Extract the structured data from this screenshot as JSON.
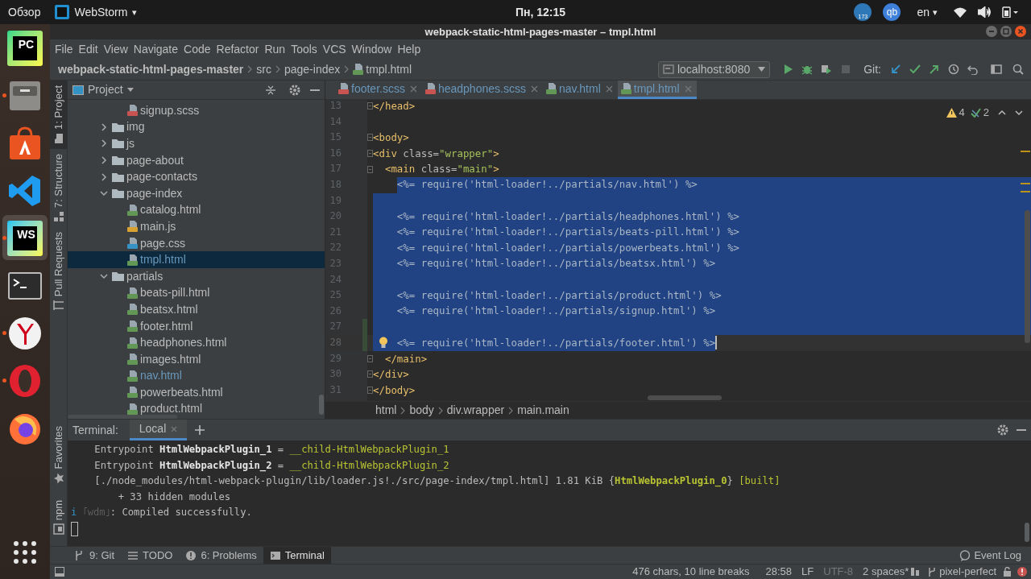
{
  "top_bar": {
    "activities": "Обзор",
    "app_menu": "WebStorm",
    "app_caret": "▾",
    "clock": "Пн, 12:15",
    "badge": "173",
    "qb": "qb",
    "language": "en",
    "language_caret": "▾"
  },
  "dock": [
    {
      "kind": "pycharm",
      "label": "PC",
      "running": false,
      "selected": false
    },
    {
      "kind": "files",
      "running": true,
      "selected": false
    },
    {
      "kind": "store",
      "running": false,
      "selected": false
    },
    {
      "kind": "vscode",
      "running": false,
      "selected": false
    },
    {
      "kind": "webstorm",
      "label": "WS",
      "running": true,
      "selected": true
    },
    {
      "kind": "terminal",
      "running": false,
      "selected": false
    },
    {
      "kind": "yandex",
      "running": true,
      "selected": false
    },
    {
      "kind": "opera",
      "running": true,
      "selected": false
    },
    {
      "kind": "firefox",
      "running": false,
      "selected": false
    },
    {
      "kind": "apps",
      "running": false,
      "selected": false
    }
  ],
  "window": {
    "title": "webpack-static-html-pages-master – tmpl.html"
  },
  "menu": [
    "File",
    "Edit",
    "View",
    "Navigate",
    "Code",
    "Refactor",
    "Run",
    "Tools",
    "VCS",
    "Window",
    "Help"
  ],
  "breadcrumbs": [
    {
      "kind": "project",
      "label": "webpack-static-html-pages-master"
    },
    {
      "kind": "folder",
      "label": "src"
    },
    {
      "kind": "folder",
      "label": "page-index"
    },
    {
      "kind": "html",
      "label": "tmpl.html"
    }
  ],
  "toolbar": {
    "run_config": "localhost:8080",
    "git_label": "Git:"
  },
  "left_stripe": [
    {
      "kind": "project",
      "label": "1: Project",
      "selected": true
    },
    {
      "kind": "structure",
      "label": "7: Structure",
      "selected": false
    },
    {
      "kind": "pull",
      "label": "Pull Requests",
      "selected": false
    }
  ],
  "left_stripe_bottom": [
    {
      "kind": "favorites",
      "label": "Favorites"
    },
    {
      "kind": "npm",
      "label": "npm"
    }
  ],
  "project": {
    "title": "Project",
    "tree_above": [
      {
        "name": "signup.scss",
        "kind": "scss",
        "selected": false,
        "modified": false
      }
    ],
    "tree": [
      {
        "name": "img",
        "kind": "folder",
        "expanded": false,
        "selected": false,
        "modified": false
      },
      {
        "name": "js",
        "kind": "folder",
        "expanded": false,
        "selected": false,
        "modified": false
      },
      {
        "name": "page-about",
        "kind": "folder",
        "expanded": false,
        "selected": false,
        "modified": false
      },
      {
        "name": "page-contacts",
        "kind": "folder",
        "expanded": false,
        "selected": false,
        "modified": false
      },
      {
        "name": "page-index",
        "kind": "folder",
        "expanded": true,
        "selected": false,
        "modified": false,
        "children": [
          {
            "name": "catalog.html",
            "kind": "html",
            "selected": false,
            "modified": false
          },
          {
            "name": "main.js",
            "kind": "js",
            "selected": false,
            "modified": false
          },
          {
            "name": "page.css",
            "kind": "css",
            "selected": false,
            "modified": false
          },
          {
            "name": "tmpl.html",
            "kind": "html",
            "selected": true,
            "modified": true
          }
        ]
      },
      {
        "name": "partials",
        "kind": "folder",
        "expanded": true,
        "selected": false,
        "modified": false,
        "children": [
          {
            "name": "beats-pill.html",
            "kind": "html",
            "selected": false,
            "modified": false
          },
          {
            "name": "beatsx.html",
            "kind": "html",
            "selected": false,
            "modified": false
          },
          {
            "name": "footer.html",
            "kind": "html",
            "selected": false,
            "modified": false
          },
          {
            "name": "headphones.html",
            "kind": "html",
            "selected": false,
            "modified": false
          },
          {
            "name": "images.html",
            "kind": "html",
            "selected": false,
            "modified": false
          },
          {
            "name": "nav.html",
            "kind": "html",
            "selected": false,
            "modified": true
          },
          {
            "name": "powerbeats.html",
            "kind": "html",
            "selected": false,
            "modified": false
          },
          {
            "name": "product.html",
            "kind": "html",
            "selected": false,
            "modified": false
          }
        ]
      }
    ]
  },
  "editor": {
    "tabs": [
      {
        "label": "footer.scss",
        "kind": "scss",
        "selected": false,
        "modified": true
      },
      {
        "label": "headphones.scss",
        "kind": "scss",
        "selected": false,
        "modified": true
      },
      {
        "label": "nav.html",
        "kind": "html",
        "selected": false,
        "modified": true
      },
      {
        "label": "tmpl.html",
        "kind": "html",
        "selected": true,
        "modified": true
      }
    ],
    "inspections": {
      "warnings": "4",
      "weak_warnings": "2"
    },
    "lines": [
      {
        "number": "13",
        "fold": true,
        "changed": false,
        "selected": false,
        "bulb": false,
        "caret": false,
        "segments": [
          {
            "kind": "tag",
            "text": "</head>"
          }
        ]
      },
      {
        "number": "14",
        "fold": false,
        "changed": false,
        "selected": false,
        "bulb": false,
        "caret": false
      },
      {
        "number": "15",
        "fold": true,
        "changed": false,
        "selected": false,
        "bulb": false,
        "caret": false,
        "segments": [
          {
            "kind": "tag",
            "text": "<body>"
          }
        ]
      },
      {
        "number": "16",
        "fold": true,
        "changed": false,
        "selected": false,
        "bulb": false,
        "caret": false,
        "segments": [
          {
            "kind": "tag",
            "text": "<div"
          },
          {
            "kind": "attr",
            "text": " class="
          },
          {
            "kind": "value",
            "text": "\"wrapper\""
          },
          {
            "kind": "tag",
            "text": ">"
          }
        ]
      },
      {
        "number": "17",
        "fold": true,
        "changed": false,
        "selected": false,
        "bulb": false,
        "caret": false,
        "segments": [
          {
            "kind": "tag",
            "text": "  <main"
          },
          {
            "kind": "attr",
            "text": " class="
          },
          {
            "kind": "value",
            "text": "\"main\""
          },
          {
            "kind": "tag",
            "text": ">"
          }
        ]
      },
      {
        "number": "18",
        "fold": false,
        "changed": false,
        "selected": true,
        "bulb": false,
        "caret": false,
        "segments": [
          {
            "kind": "text",
            "text": "    <%= require('html-loader!../partials/nav.html') %>"
          }
        ]
      },
      {
        "number": "19",
        "fold": false,
        "changed": false,
        "selected": true,
        "bulb": false,
        "caret": false
      },
      {
        "number": "20",
        "fold": false,
        "changed": false,
        "selected": true,
        "bulb": false,
        "caret": false,
        "segments": [
          {
            "kind": "text",
            "text": "    <%= require('html-loader!../partials/headphones.html') %>"
          }
        ]
      },
      {
        "number": "21",
        "fold": false,
        "changed": false,
        "selected": true,
        "bulb": false,
        "caret": false,
        "segments": [
          {
            "kind": "text",
            "text": "    <%= require('html-loader!../partials/beats-pill.html') %>"
          }
        ]
      },
      {
        "number": "22",
        "fold": false,
        "changed": false,
        "selected": true,
        "bulb": false,
        "caret": false,
        "segments": [
          {
            "kind": "text",
            "text": "    <%= require('html-loader!../partials/powerbeats.html') %>"
          }
        ]
      },
      {
        "number": "23",
        "fold": false,
        "changed": false,
        "selected": true,
        "bulb": false,
        "caret": false,
        "segments": [
          {
            "kind": "text",
            "text": "    <%= require('html-loader!../partials/beatsx.html') %>"
          }
        ]
      },
      {
        "number": "24",
        "fold": false,
        "changed": false,
        "selected": true,
        "bulb": false,
        "caret": false
      },
      {
        "number": "25",
        "fold": false,
        "changed": false,
        "selected": true,
        "bulb": false,
        "caret": false,
        "segments": [
          {
            "kind": "text",
            "text": "    <%= require('html-loader!../partials/product.html') %>"
          }
        ]
      },
      {
        "number": "26",
        "fold": false,
        "changed": false,
        "selected": true,
        "bulb": false,
        "caret": false,
        "segments": [
          {
            "kind": "text",
            "text": "    <%= require('html-loader!../partials/signup.html') %>"
          }
        ]
      },
      {
        "number": "27",
        "fold": false,
        "changed": true,
        "selected": true,
        "bulb": false,
        "caret": false
      },
      {
        "number": "28",
        "fold": false,
        "changed": true,
        "selected": true,
        "bulb": true,
        "caret": true,
        "segments": [
          {
            "kind": "text",
            "text": "    <%= require('html-loader!../partials/footer.html') %>"
          }
        ]
      },
      {
        "number": "29",
        "fold": true,
        "changed": false,
        "selected": false,
        "bulb": false,
        "caret": false,
        "segments": [
          {
            "kind": "tag",
            "text": "  </main>"
          }
        ]
      },
      {
        "number": "30",
        "fold": true,
        "changed": false,
        "selected": false,
        "bulb": false,
        "caret": false,
        "segments": [
          {
            "kind": "tag",
            "text": "</div>"
          }
        ]
      },
      {
        "number": "31",
        "fold": true,
        "changed": false,
        "selected": false,
        "bulb": false,
        "caret": false,
        "segments": [
          {
            "kind": "tag",
            "text": "</body>"
          }
        ]
      }
    ],
    "breadcrumbs": [
      "html",
      "body",
      "div.wrapper",
      "main.main"
    ]
  },
  "terminal": {
    "title": "Terminal:",
    "tabs": [
      {
        "label": "Local",
        "selected": true
      }
    ],
    "cursor": true,
    "lines": [
      [
        {
          "kind": "plain",
          "text": "    Entrypoint "
        },
        {
          "kind": "bold",
          "text": "HtmlWebpackPlugin_1"
        },
        {
          "kind": "plain",
          "text": " = "
        },
        {
          "kind": "accent",
          "text": "__child-HtmlWebpackPlugin_1"
        }
      ],
      [
        {
          "kind": "plain",
          "text": "    Entrypoint "
        },
        {
          "kind": "bold",
          "text": "HtmlWebpackPlugin_2"
        },
        {
          "kind": "plain",
          "text": " = "
        },
        {
          "kind": "accent",
          "text": "__child-HtmlWebpackPlugin_2"
        }
      ],
      [
        {
          "kind": "plain",
          "text": "    [./node_modules/html-webpack-plugin/lib/loader.js!./src/page-index/tmpl.html] 1.81 KiB {"
        },
        {
          "kind": "accent_bold",
          "text": "HtmlWebpackPlugin_0"
        },
        {
          "kind": "plain",
          "text": "} "
        },
        {
          "kind": "accent",
          "text": "[built]"
        }
      ],
      [
        {
          "kind": "plain",
          "text": "        + 33 hidden modules"
        }
      ],
      [
        {
          "kind": "info",
          "text": "i"
        },
        {
          "kind": "dim",
          "text": " ｢wdm｣"
        },
        {
          "kind": "plain",
          "text": ": Compiled successfully."
        }
      ]
    ]
  },
  "tool_tabs": [
    {
      "kind": "git",
      "label": "9: Git",
      "selected": false
    },
    {
      "kind": "todo",
      "label": "TODO",
      "selected": false
    },
    {
      "kind": "problems",
      "label": "6: Problems",
      "selected": false
    },
    {
      "kind": "terminal",
      "label": "Terminal",
      "selected": true
    }
  ],
  "event_log": "Event Log",
  "status": {
    "selection": "476 chars, 10 line breaks",
    "position": "28:58",
    "line_separator": "LF",
    "encoding": "UTF-8",
    "indent": "2 spaces*",
    "branch": "pixel-perfect"
  }
}
